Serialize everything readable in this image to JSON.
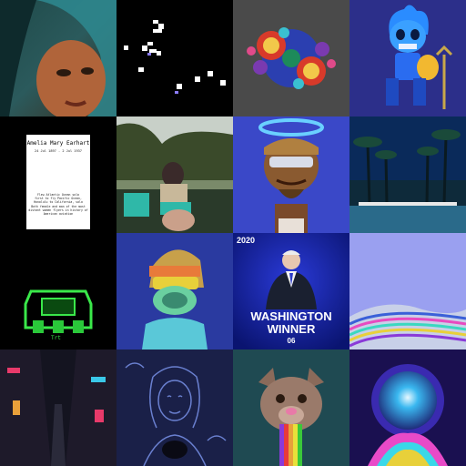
{
  "gallery": {
    "tiles": [
      {
        "name": "portrait-painting",
        "caption": ""
      },
      {
        "name": "pixel-sprites",
        "caption": ""
      },
      {
        "name": "fractal-art",
        "caption": ""
      },
      {
        "name": "blue-skull-character",
        "caption": ""
      },
      {
        "name": "earhart-memorial-card",
        "caption": ""
      },
      {
        "name": "photo-woman-garden",
        "caption": ""
      },
      {
        "name": "haloed-character",
        "caption": ""
      },
      {
        "name": "palm-pool-night",
        "caption": ""
      },
      {
        "name": "green-neon-mech",
        "caption": ""
      },
      {
        "name": "masked-figure",
        "caption": ""
      },
      {
        "name": "washington-winner",
        "caption": ""
      },
      {
        "name": "lavender-wave",
        "caption": ""
      },
      {
        "name": "neon-alley",
        "caption": ""
      },
      {
        "name": "line-art-woman",
        "caption": ""
      },
      {
        "name": "pitbull-rainbow",
        "caption": ""
      },
      {
        "name": "cosmic-astronaut",
        "caption": ""
      }
    ],
    "earhart": {
      "name": "Amelia Mary Earhart",
      "dates": "24 Jul 1897 - 2 Jul 1937",
      "body": "Flew Atlantic Ocean solo\nfirst to fly Pacific Ocean,\nHonolulu to California, solo\nBoth female and man of the most\ndistant women flyers in history of\nAmerican aviation"
    },
    "washington": {
      "year": "2020",
      "line1": "WASHINGTON",
      "line2": "WINNER",
      "number": "06"
    },
    "mech_label": "Trt"
  }
}
